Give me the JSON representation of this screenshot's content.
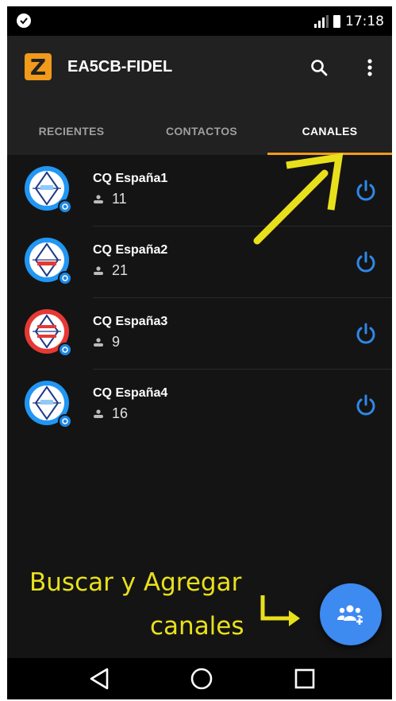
{
  "status_bar": {
    "time": "17:18",
    "icons": [
      "check-circle-icon",
      "signal-icon",
      "battery-icon"
    ]
  },
  "toolbar": {
    "logo_letter": "Z",
    "title": "EA5CB-FIDEL",
    "search_icon": "search-icon",
    "menu_icon": "more-vertical-icon",
    "accent": "#f19a1b"
  },
  "tabs": [
    {
      "label": "RECIENTES",
      "active": false
    },
    {
      "label": "CONTACTOS",
      "active": false
    },
    {
      "label": "CANALES",
      "active": true
    }
  ],
  "channels": [
    {
      "name": "CQ España1",
      "users": "11",
      "ring_color": "#2196f3"
    },
    {
      "name": "CQ España2",
      "users": "21",
      "ring_color": "#2196f3"
    },
    {
      "name": "CQ España3",
      "users": "9",
      "ring_color": "#e53935"
    },
    {
      "name": "CQ España4",
      "users": "16",
      "ring_color": "#2196f3"
    }
  ],
  "hint": {
    "line1": "Buscar y Agregar",
    "line2": "canales",
    "color": "#e9e01c"
  },
  "fab": {
    "icon": "add-group-icon",
    "color": "#3d8af0"
  },
  "navbar": {
    "icons": [
      "back-icon",
      "home-icon",
      "recents-icon"
    ]
  }
}
